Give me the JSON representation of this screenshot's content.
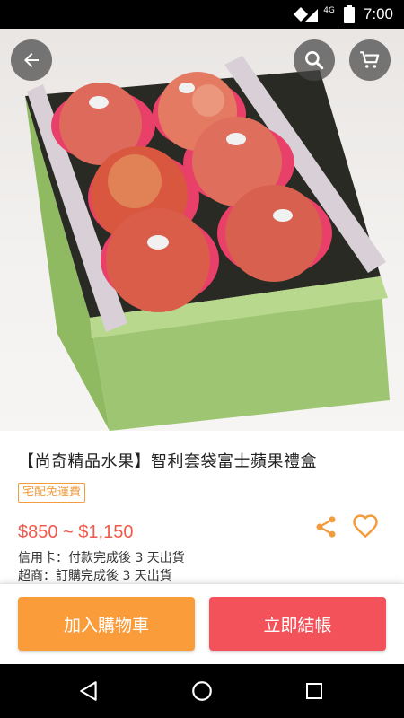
{
  "status_bar": {
    "time": "7:00",
    "network": "4G",
    "icons": [
      "wifi-icon",
      "signal-icon",
      "battery-icon"
    ]
  },
  "header": {
    "back_icon": "arrow-left-icon",
    "search_icon": "search-icon",
    "cart_icon": "cart-icon"
  },
  "product": {
    "title": "【尚奇精品水果】智利套袋富士蘋果禮盒",
    "shipping_badge": "宅配免運費",
    "price": "$850 ~ $1,150",
    "delivery_card": "信用卡：付款完成後 3 天出貨",
    "delivery_store": "超商：訂購完成後 3 天出貨",
    "share_icon": "share-icon",
    "favorite_icon": "heart-outline-icon"
  },
  "actions": {
    "add_to_cart": "加入購物車",
    "checkout": "立即結帳"
  },
  "colors": {
    "accent_orange": "#fb9c3a",
    "accent_red": "#f4525a",
    "price_red": "#f05a4d",
    "badge_orange": "#f39c3d"
  },
  "nav": {
    "icons": [
      "nav-back-icon",
      "nav-home-icon",
      "nav-recents-icon"
    ]
  }
}
